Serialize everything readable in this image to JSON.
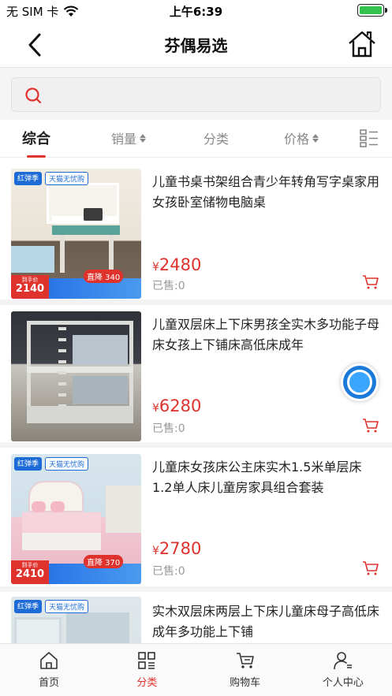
{
  "status_bar": {
    "carrier": "无 SIM 卡",
    "time": "上午6:39"
  },
  "nav": {
    "title": "芬偶易选"
  },
  "search": {
    "placeholder": "",
    "value": ""
  },
  "tabs": [
    {
      "label": "综合",
      "active": true
    },
    {
      "label": "销量",
      "sortable": true
    },
    {
      "label": "分类"
    },
    {
      "label": "价格",
      "sortable": true
    }
  ],
  "currency": "¥",
  "products": [
    {
      "title": "儿童书桌书架组合青少年转角写字桌家用女孩卧室储物电脑桌",
      "price": "2480",
      "sold": "已售:0",
      "thumb": {
        "badge1": "红弹季",
        "badge2": "天猫无忧购",
        "promo_label": "到手价",
        "promo_price": "2140",
        "drop": "直降 340"
      }
    },
    {
      "title": "儿童双层床上下床男孩全实木多功能子母床女孩上下铺床高低床成年",
      "price": "6280",
      "sold": "已售:0",
      "thumb": null
    },
    {
      "title": "儿童床女孩床公主床实木1.5米单层床1.2单人床儿童房家具组合套装",
      "price": "2780",
      "sold": "已售:0",
      "thumb": {
        "badge1": "红弹季",
        "badge2": "天猫无忧购",
        "promo_label": "到手价",
        "promo_price": "2410",
        "drop": "直降 370"
      }
    },
    {
      "title": "实木双层床两层上下床儿童床母子高低床成年多功能上下铺",
      "price": "",
      "sold": "",
      "thumb": {
        "badge1": "红弹季",
        "badge2": "天猫无忧购"
      }
    }
  ],
  "tabbar": [
    {
      "label": "首页",
      "icon": "home-icon"
    },
    {
      "label": "分类",
      "icon": "category-icon",
      "active": true
    },
    {
      "label": "购物车",
      "icon": "cart-icon"
    },
    {
      "label": "个人中心",
      "icon": "profile-icon"
    }
  ],
  "colors": {
    "accent": "#e0322d",
    "float_button": "#3aa5ff",
    "battery": "#32c24d"
  }
}
